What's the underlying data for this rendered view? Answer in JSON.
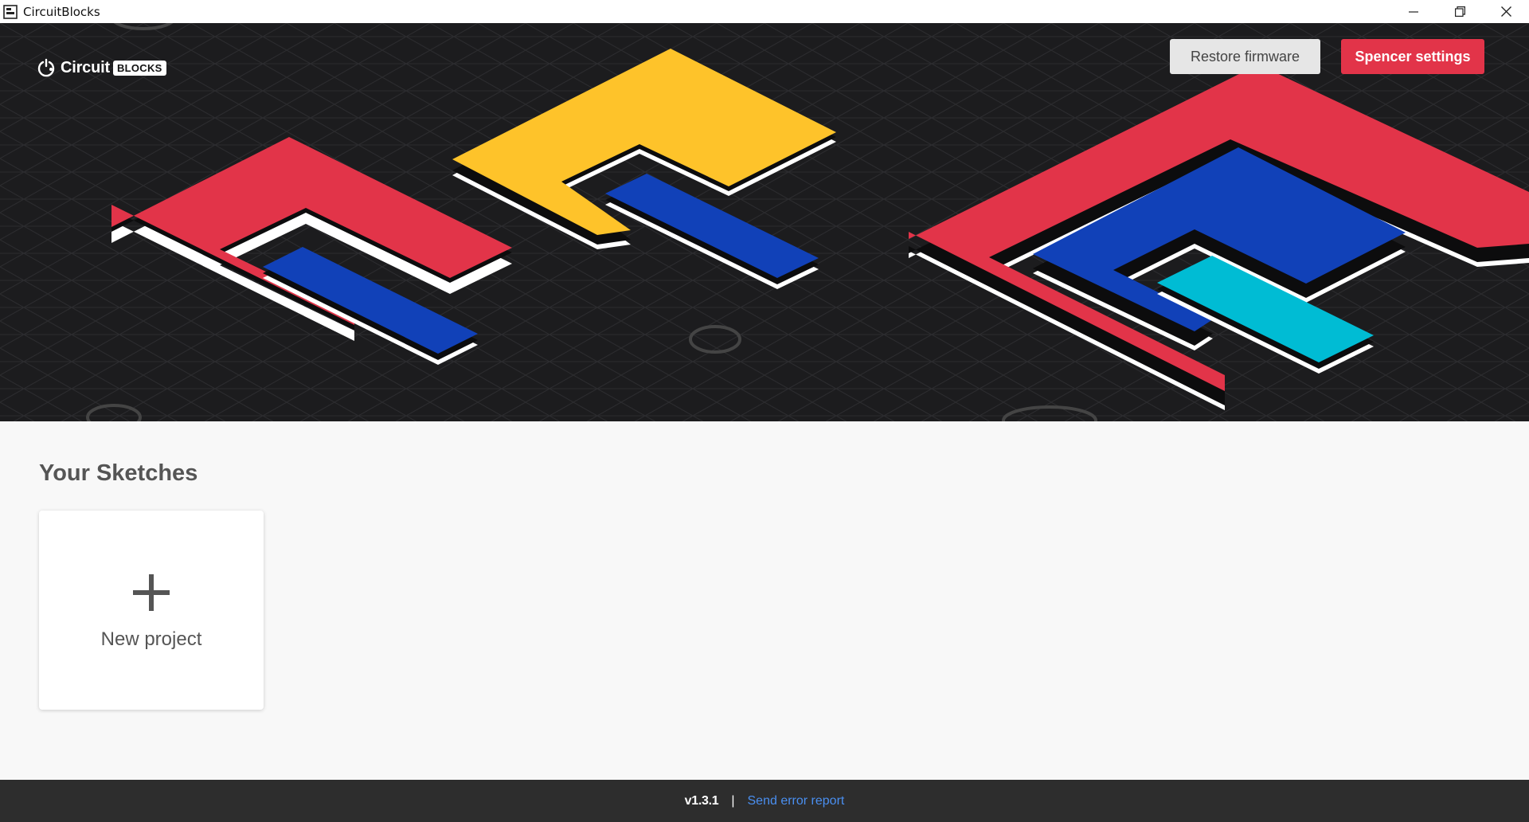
{
  "window": {
    "title": "CircuitBlocks",
    "controls": [
      "minimize",
      "restore",
      "close"
    ]
  },
  "header": {
    "logo_word": "Circuit",
    "logo_badge": "BLOCKS",
    "restore_firmware_label": "Restore firmware",
    "spencer_settings_label": "Spencer settings"
  },
  "colors": {
    "hero_background": "#1c1c1e",
    "red": "#e23449",
    "yellow": "#fec32a",
    "blue": "#1141b8",
    "cyan": "#00bcd4",
    "footer_background": "#2d2d2d",
    "link": "#4a8ff0"
  },
  "sketches": {
    "title": "Your Sketches",
    "new_project_label": "New project",
    "new_project_icon": "plus-icon"
  },
  "footer": {
    "version": "v1.3.1",
    "separator": "|",
    "report_label": "Send error report"
  }
}
